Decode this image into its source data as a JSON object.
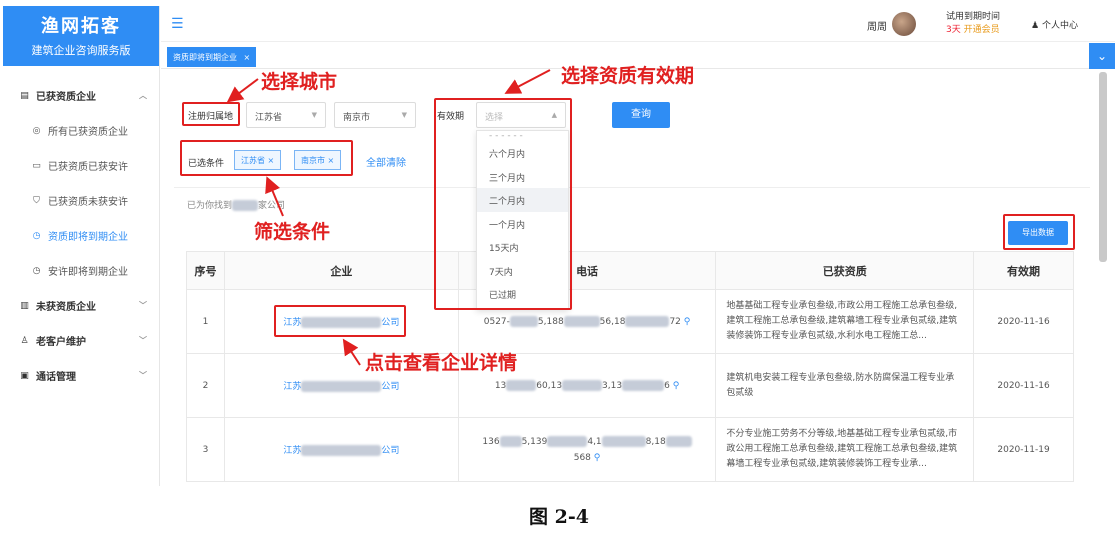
{
  "brand": {
    "title": "渔网拓客",
    "subtitle": "建筑企业咨询服务版"
  },
  "sidebar": {
    "sections": [
      {
        "label": "已获资质企业",
        "chevron": "^"
      },
      {
        "label": "所有已获资质企业"
      },
      {
        "label": "已获资质已获安许"
      },
      {
        "label": "已获资质未获安许"
      },
      {
        "label": "资质即将到期企业"
      },
      {
        "label": "安许即将到期企业"
      },
      {
        "label": "未获资质企业",
        "chevron": "v"
      },
      {
        "label": "老客户维护",
        "chevron": "v"
      },
      {
        "label": "通话管理",
        "chevron": "v"
      }
    ]
  },
  "header": {
    "user_name": "周周",
    "trial_label": "试用到期时间",
    "trial_days": "3天",
    "trial_action": "开通会员",
    "personal_center": "个人中心"
  },
  "tabs": [
    {
      "label": "资质即将到期企业",
      "close": "×"
    }
  ],
  "filter": {
    "region_label": "注册归属地",
    "province": "江苏省",
    "city": "南京市",
    "validity_label": "有效期",
    "validity_placeholder": "选择",
    "query_button": "查询",
    "selected_label": "已选条件",
    "chips": [
      "江苏省 ×",
      "南京市 ×"
    ],
    "clear_all": "全部清除"
  },
  "dropdown": {
    "options": [
      "六个月内",
      "三个月内",
      "二个月内",
      "一个月内",
      "15天内",
      "7天内",
      "已过期"
    ],
    "highlighted": "二个月内"
  },
  "result": {
    "found_prefix": "已为你找到",
    "found_suffix": "家公司",
    "export_button": "导出数据"
  },
  "table": {
    "headers": [
      "序号",
      "企业",
      "电话",
      "已获资质",
      "有效期"
    ],
    "rows": [
      {
        "index": "1",
        "company_start": "江苏",
        "company_end": "公司",
        "phone_a": "0527-",
        "phone_b": "5,188",
        "phone_c": "56,18",
        "phone_d": "72",
        "qualification": "地基基础工程专业承包叁级,市政公用工程施工总承包叁级,建筑工程施工总承包叁级,建筑幕墙工程专业承包贰级,建筑装修装饰工程专业承包贰级,水利水电工程施工总...",
        "expiry": "2020-11-16"
      },
      {
        "index": "2",
        "company_start": "江苏",
        "company_end": "公司",
        "phone_a": "13",
        "phone_b": "60,13",
        "phone_c": "3,13",
        "phone_d": "6",
        "qualification": "建筑机电安装工程专业承包叁级,防水防腐保温工程专业承包贰级",
        "expiry": "2020-11-16"
      },
      {
        "index": "3",
        "company_start": "江苏",
        "company_end": "公司",
        "phone_a": "136",
        "phone_b": "5,139",
        "phone_c": "4,1",
        "phone_d": "8,18",
        "phone_e": "568",
        "qualification": "不分专业施工劳务不分等级,地基基础工程专业承包贰级,市政公用工程施工总承包叁级,建筑工程施工总承包叁级,建筑幕墙工程专业承包贰级,建筑装修装饰工程专业承...",
        "expiry": "2020-11-19"
      }
    ]
  },
  "annotations": {
    "select_city": "选择城市",
    "select_validity": "选择资质有效期",
    "filter_conditions": "筛选条件",
    "click_detail": "点击查看企业详情"
  },
  "caption": "图 2-4",
  "colors": {
    "primary": "#2f8df4",
    "annotation": "#e02020"
  }
}
